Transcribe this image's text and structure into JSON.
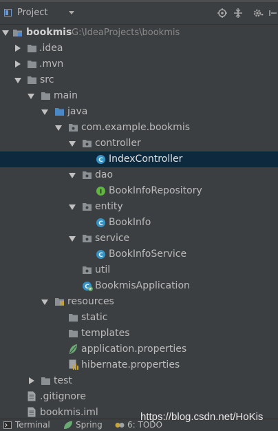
{
  "header": {
    "title": "Project",
    "icons": [
      "locate-icon",
      "collapse-all-icon",
      "settings-icon",
      "hide-icon"
    ]
  },
  "tree": [
    {
      "label": "bookmis",
      "path": "G:\\IdeaProjects\\bookmis",
      "kind": "module",
      "expanded": true,
      "depth": 0
    },
    {
      "label": ".idea",
      "kind": "folder",
      "expanded": false,
      "depth": 1
    },
    {
      "label": ".mvn",
      "kind": "folder",
      "expanded": false,
      "depth": 1
    },
    {
      "label": "src",
      "kind": "folder",
      "expanded": true,
      "depth": 1
    },
    {
      "label": "main",
      "kind": "folder",
      "expanded": true,
      "depth": 2
    },
    {
      "label": "java",
      "kind": "source-folder",
      "expanded": true,
      "depth": 3
    },
    {
      "label": "com.example.bookmis",
      "kind": "package",
      "expanded": true,
      "depth": 4
    },
    {
      "label": "controller",
      "kind": "package",
      "expanded": true,
      "depth": 5
    },
    {
      "label": "IndexController",
      "kind": "class",
      "depth": 6,
      "selected": true
    },
    {
      "label": "dao",
      "kind": "package",
      "expanded": true,
      "depth": 5
    },
    {
      "label": "BookInfoRepository",
      "kind": "interface",
      "depth": 6
    },
    {
      "label": "entity",
      "kind": "package",
      "expanded": true,
      "depth": 5
    },
    {
      "label": "BookInfo",
      "kind": "class",
      "depth": 6
    },
    {
      "label": "service",
      "kind": "package",
      "expanded": true,
      "depth": 5
    },
    {
      "label": "BookInfoService",
      "kind": "class",
      "depth": 6
    },
    {
      "label": "util",
      "kind": "package",
      "depth": 5
    },
    {
      "label": "BookmisApplication",
      "kind": "spring-class",
      "depth": 5
    },
    {
      "label": "resources",
      "kind": "resources-folder",
      "expanded": true,
      "depth": 3
    },
    {
      "label": "static",
      "kind": "folder",
      "depth": 4
    },
    {
      "label": "templates",
      "kind": "folder",
      "depth": 4
    },
    {
      "label": "application.properties",
      "kind": "spring-properties",
      "depth": 4
    },
    {
      "label": "hibernate.properties",
      "kind": "properties",
      "depth": 4
    },
    {
      "label": "test",
      "kind": "folder",
      "expanded": false,
      "depth": 2
    },
    {
      "label": ".gitignore",
      "kind": "file",
      "depth": 1
    },
    {
      "label": "bookmis.iml",
      "kind": "file",
      "depth": 1
    }
  ],
  "bottom_tabs": [
    {
      "label": "Terminal",
      "icon": "terminal-icon"
    },
    {
      "label": "Spring",
      "icon": "spring-icon"
    },
    {
      "label": "6: TODO",
      "icon": "todo-icon"
    }
  ],
  "watermark": "https://blog.csdn.net/HoKis",
  "colors": {
    "background": "#3c3f41",
    "selection": "#0d293e",
    "text": "#bbbbbb",
    "folder": "#8b9094",
    "source_folder": "#4a88c7",
    "class_badge": "#3592c4",
    "interface_badge": "#62b543",
    "spring": "#6aab73"
  }
}
